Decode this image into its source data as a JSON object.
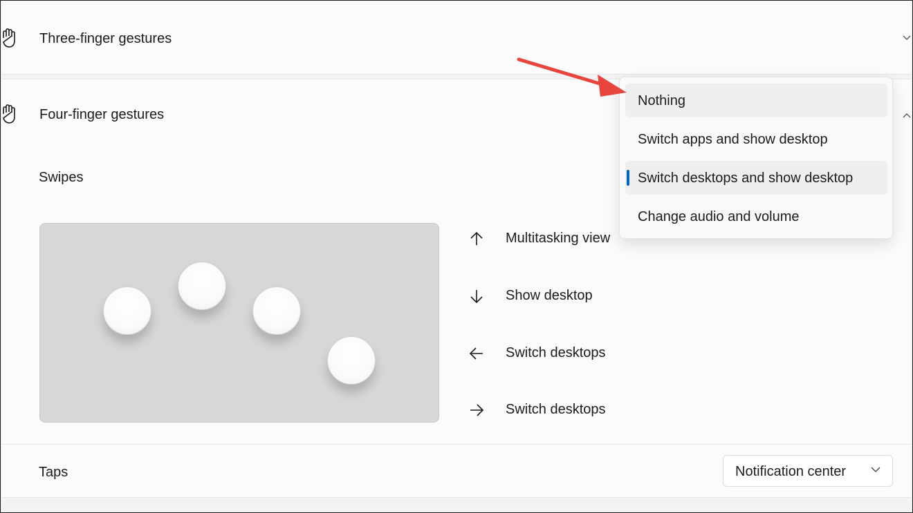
{
  "three_finger": {
    "label": "Three-finger gestures",
    "icon": "hand-icon"
  },
  "four_finger": {
    "label": "Four-finger gestures",
    "icon": "hand-icon"
  },
  "swipes": {
    "label": "Swipes",
    "directions": [
      {
        "icon": "arrow-up-icon",
        "label": "Multitasking view"
      },
      {
        "icon": "arrow-down-icon",
        "label": "Show desktop"
      },
      {
        "icon": "arrow-left-icon",
        "label": "Switch desktops"
      },
      {
        "icon": "arrow-right-icon",
        "label": "Switch desktops"
      }
    ]
  },
  "taps": {
    "label": "Taps",
    "value": "Notification center"
  },
  "dropdown": {
    "options": [
      {
        "label": "Nothing",
        "state": "hover"
      },
      {
        "label": "Switch apps and show desktop",
        "state": "normal"
      },
      {
        "label": "Switch desktops and show desktop",
        "state": "selected"
      },
      {
        "label": "Change audio and volume",
        "state": "normal"
      }
    ]
  },
  "colors": {
    "accent": "#0067c0",
    "annotation_arrow": "#e8453c"
  }
}
